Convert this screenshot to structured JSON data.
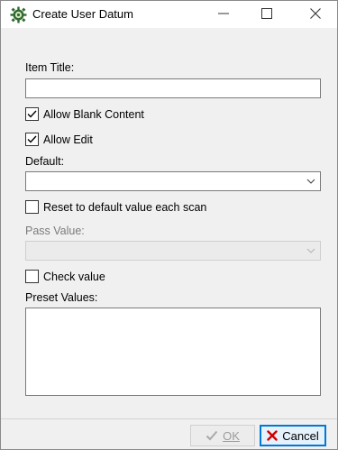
{
  "window": {
    "title": "Create User Datum",
    "app_icon": "gear-icon",
    "controls": {
      "minimize": "minimize-icon",
      "maximize": "maximize-icon",
      "close": "close-icon"
    }
  },
  "form": {
    "item_title": {
      "label": "Item Title:",
      "value": ""
    },
    "allow_blank_content": {
      "label": "Allow Blank Content",
      "checked": true
    },
    "allow_edit": {
      "label": "Allow Edit",
      "checked": true
    },
    "default": {
      "label": "Default:",
      "value": ""
    },
    "reset_each_scan": {
      "label": "Reset to default value each scan",
      "checked": false
    },
    "pass_value": {
      "label": "Pass Value:",
      "value": "",
      "disabled": true
    },
    "check_value": {
      "label": "Check value",
      "checked": false
    },
    "preset_values": {
      "label": "Preset Values:",
      "value": ""
    }
  },
  "buttons": {
    "ok": {
      "label": "OK",
      "icon": "checkmark-icon",
      "disabled": true
    },
    "cancel": {
      "label": "Cancel",
      "icon": "x-icon",
      "icon_color": "#d10000"
    }
  }
}
